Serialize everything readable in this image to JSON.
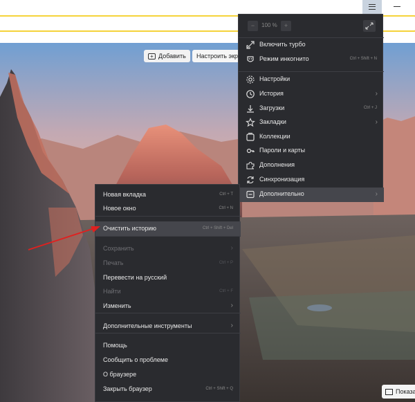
{
  "ntp": {
    "add_label": "Добавить",
    "setup_label": "Настроить экра"
  },
  "main_menu": {
    "zoom": {
      "minus": "−",
      "value": "100 %",
      "plus": "+"
    },
    "items": [
      {
        "label": "Включить турбо",
        "shortcut": "",
        "icon": "rocket-icon"
      },
      {
        "label": "Режим инкогнито",
        "shortcut": "Ctrl + Shift + N",
        "icon": "mask-icon"
      },
      {
        "label": "Настройки",
        "shortcut": "",
        "icon": "gear-icon"
      },
      {
        "label": "История",
        "shortcut": "",
        "icon": "clock-icon",
        "submenu": true
      },
      {
        "label": "Загрузки",
        "shortcut": "Ctrl + J",
        "icon": "download-icon"
      },
      {
        "label": "Закладки",
        "shortcut": "",
        "icon": "star-icon",
        "submenu": true
      },
      {
        "label": "Коллекции",
        "shortcut": "",
        "icon": "collections-icon"
      },
      {
        "label": "Пароли и карты",
        "shortcut": "",
        "icon": "key-icon"
      },
      {
        "label": "Дополнения",
        "shortcut": "",
        "icon": "puzzle-icon"
      },
      {
        "label": "Синхронизация",
        "shortcut": "",
        "icon": "sync-icon"
      },
      {
        "label": "Дополнительно",
        "shortcut": "",
        "icon": "more-icon",
        "submenu": true
      }
    ],
    "arrow": "›"
  },
  "sub_menu": {
    "items": [
      {
        "label": "Новая вкладка",
        "shortcut": "Ctrl + T"
      },
      {
        "label": "Новое окно",
        "shortcut": "Ctrl + N"
      },
      {
        "label": "Очистить историю",
        "shortcut": "Ctrl + Shift + Del"
      },
      {
        "label": "Сохранить",
        "shortcut": ""
      },
      {
        "label": "Печать",
        "shortcut": "Ctrl + P"
      },
      {
        "label": "Перевести на русский",
        "shortcut": ""
      },
      {
        "label": "Найти",
        "shortcut": "Ctrl + F"
      },
      {
        "label": "Изменить",
        "shortcut": ""
      },
      {
        "label": "Дополнительные инструменты",
        "shortcut": ""
      },
      {
        "label": "Помощь",
        "shortcut": ""
      },
      {
        "label": "Сообщить о проблеме",
        "shortcut": ""
      },
      {
        "label": "О браузере",
        "shortcut": ""
      },
      {
        "label": "Закрыть браузер",
        "shortcut": "Ctrl + Shift + Q"
      }
    ]
  },
  "show_button": {
    "label": "Показа"
  },
  "colors": {
    "accent": "#f5d33a",
    "menu_bg": "#2a2b2f",
    "annotation": "#e0201f"
  }
}
